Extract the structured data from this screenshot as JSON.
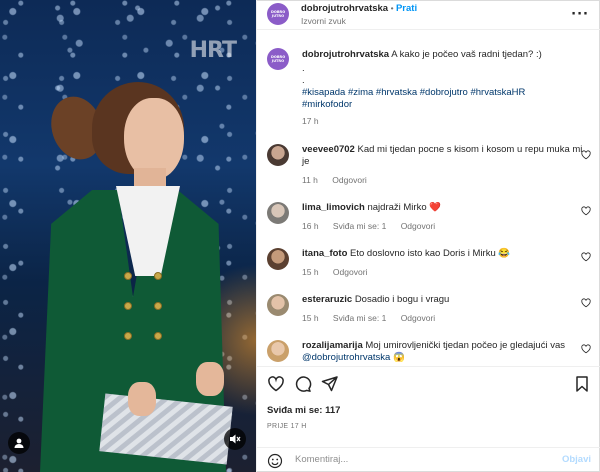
{
  "post": {
    "username": "dobrojutrohrvatska",
    "follow_label": "Prati",
    "audio_label": "Izvorni zvuk",
    "avatar_text": "DOBRO JUTRO",
    "caption_user": "dobrojutrohrvatska",
    "caption_text": "A kako je počeo vaš radni tjedan? :)",
    "caption_dot1": ".",
    "caption_dot2": ".",
    "hashtags_line1": "#kisapada #zima #hrvatska #dobrojutro #hrvatskaHR",
    "hashtags_line2": "#mirkofodor",
    "caption_time": "17 h",
    "more_icon": "more-horizontal-icon"
  },
  "video": {
    "channel_logo": "HRT",
    "user_icon": "user-icon",
    "mute_icon": "speaker-muted-icon"
  },
  "comments": [
    {
      "user": "veevee0702",
      "text": "Kad mi tjedan pocne s kisom i kosom u repu muka mi je",
      "time": "11 h",
      "likes": "",
      "reply": "Odgovori"
    },
    {
      "user": "lima_limovich",
      "text": "najdraži Mirko ❤️",
      "time": "16 h",
      "likes": "Sviđa mi se: 1",
      "reply": "Odgovori"
    },
    {
      "user": "itana_foto",
      "text": "Eto doslovno isto kao Doris i Mirku 😂",
      "time": "15 h",
      "likes": "",
      "reply": "Odgovori"
    },
    {
      "user": "esteraruzic",
      "text": "Dosadio i bogu i vragu",
      "time": "15 h",
      "likes": "Sviđa mi se: 1",
      "reply": "Odgovori"
    },
    {
      "user": "rozalijamarija",
      "text": "Moj umirovljenički tjedan počeo je gledajući vas",
      "mention": "@dobrojutrohrvatska",
      "emoji": "😱"
    }
  ],
  "actions": {
    "like_icon": "heart-icon",
    "comment_icon": "comment-icon",
    "share_icon": "send-icon",
    "save_icon": "bookmark-icon",
    "likes_label": "Sviđa mi se:",
    "likes_count": "117",
    "timestamp": "PRIJE 17 H"
  },
  "comment_box": {
    "emoji_icon": "smiley-icon",
    "placeholder": "Komentiraj...",
    "post_label": "Objavi"
  },
  "colors": {
    "link": "#00376b",
    "follow": "#0095f6",
    "post_disabled": "#b3dbff",
    "brand_avatar": "#8b5cc8",
    "heart_red": "#e0245e"
  }
}
